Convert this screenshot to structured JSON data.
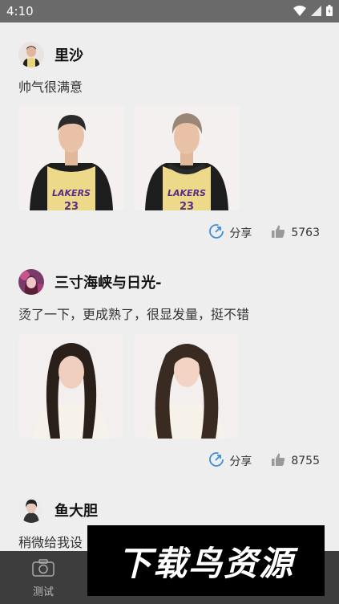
{
  "status_bar": {
    "time": "4:10",
    "icons": [
      "wifi-icon",
      "signal-icon",
      "battery-icon"
    ]
  },
  "posts": [
    {
      "username": "里沙",
      "text": "帅气很满意",
      "share_label": "分享",
      "likes": "5763",
      "photos": [
        "jersey-boy-photo-1",
        "jersey-boy-photo-2"
      ]
    },
    {
      "username": "三寸海峡与日光-",
      "text": "烫了一下，更成熟了，很显发量，挺不错",
      "share_label": "分享",
      "likes": "8755",
      "photos": [
        "long-hair-girl-photo-1",
        "long-hair-girl-photo-2"
      ]
    },
    {
      "username": "鱼大胆",
      "text": "稍微给我设",
      "photos": []
    }
  ],
  "bottom_nav": {
    "items": [
      {
        "label": "测试",
        "icon": "camera-icon"
      }
    ]
  },
  "watermark": {
    "text": "下载鸟资源"
  },
  "colors": {
    "status_bar": "#6a6a6a",
    "background": "#eeeeee",
    "share_icon": "#3a8fd8",
    "like_icon": "#999999",
    "bottom_nav": "#3d3d3d"
  }
}
